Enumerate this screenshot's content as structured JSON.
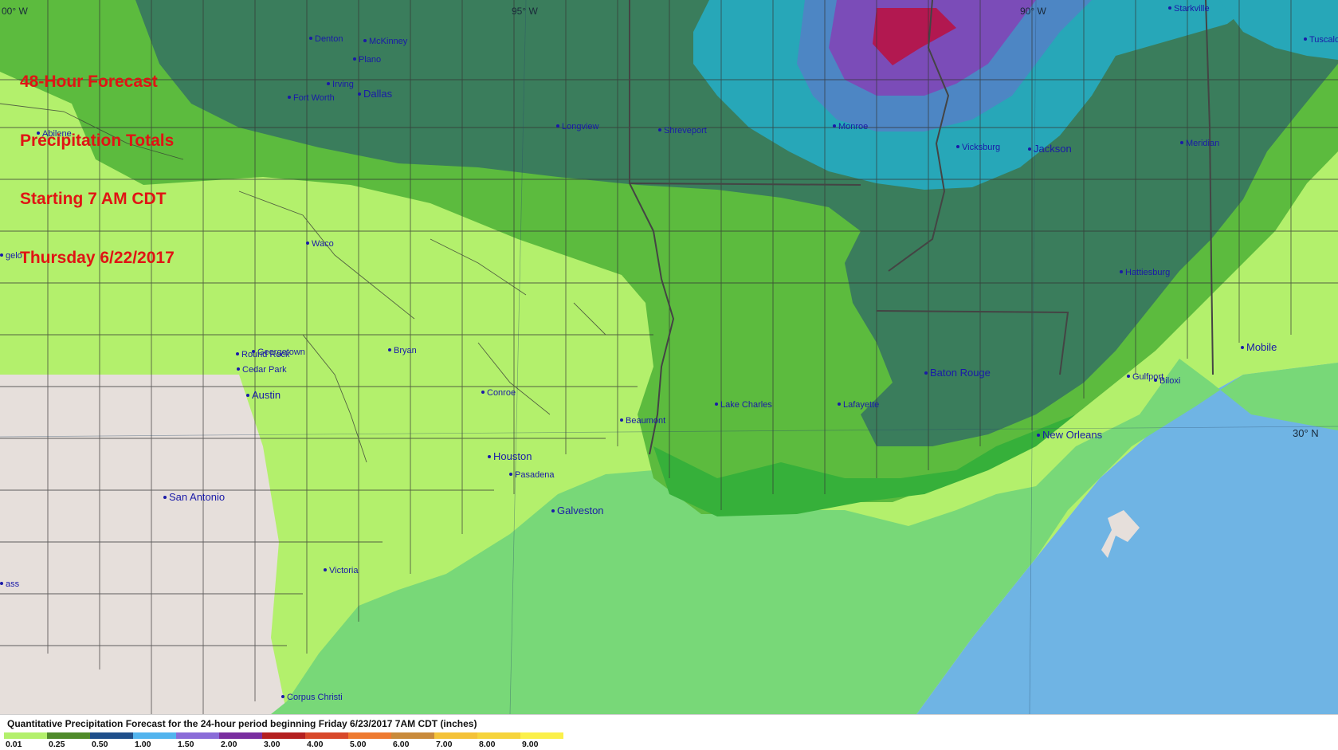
{
  "title_lines": [
    "48-Hour Forecast",
    "Precipitation Totals",
    "Starting 7 AM CDT",
    "Thursday 6/22/2017"
  ],
  "graticule_labels": {
    "lon_100": "00° W",
    "lon_95": "95° W",
    "lon_90": "90° W",
    "lat_30": "30° N"
  },
  "legend": {
    "title": "Quantitative Precipitation Forecast for the 24-hour period beginning Friday 6/23/2017 7AM CDT (inches)",
    "items": [
      {
        "value": "0.01",
        "color": "#b3f06c"
      },
      {
        "value": "0.25",
        "color": "#4f8a2a"
      },
      {
        "value": "0.50",
        "color": "#1f4f8a"
      },
      {
        "value": "1.00",
        "color": "#52b4ee"
      },
      {
        "value": "1.50",
        "color": "#8a6cd8"
      },
      {
        "value": "2.00",
        "color": "#7a2ea0"
      },
      {
        "value": "3.00",
        "color": "#b42020"
      },
      {
        "value": "4.00",
        "color": "#d8482a"
      },
      {
        "value": "5.00",
        "color": "#ee7a30"
      },
      {
        "value": "6.00",
        "color": "#c98a3a"
      },
      {
        "value": "7.00",
        "color": "#f4c238"
      },
      {
        "value": "8.00",
        "color": "#f6d43c"
      },
      {
        "value": "9.00",
        "color": "#fbf04a"
      }
    ]
  },
  "colors": {
    "land_no_precip": "#e6dfdb",
    "gulf": "#6fb4e4",
    "light_green": "#b3f06c",
    "mid_green": "#5cbb3e",
    "bright_green": "#36b03a",
    "gulf_green": "#78d878",
    "dark_green": "#3a7d5c",
    "teal": "#27a7b8",
    "steel_blue": "#4d86c4",
    "purple": "#7b4cb8",
    "crimson": "#b21850",
    "title_red": "#e01414",
    "city_label": "#1a1aa8"
  },
  "cities": [
    {
      "name": "Denton"
    },
    {
      "name": "McKinney"
    },
    {
      "name": "Plano"
    },
    {
      "name": "Irving"
    },
    {
      "name": "Fort Worth"
    },
    {
      "name": "Dallas"
    },
    {
      "name": "Abilene"
    },
    {
      "name": "Longview"
    },
    {
      "name": "Shreveport"
    },
    {
      "name": "Monroe"
    },
    {
      "name": "Vicksburg"
    },
    {
      "name": "Jackson"
    },
    {
      "name": "Meridian"
    },
    {
      "name": "Starkville"
    },
    {
      "name": "Tuscaloo"
    },
    {
      "name": "Waco"
    },
    {
      "name": "gelo"
    },
    {
      "name": "Hattiesburg"
    },
    {
      "name": "Round Rock"
    },
    {
      "name": "Georgetown"
    },
    {
      "name": "Cedar Park"
    },
    {
      "name": "Bryan"
    },
    {
      "name": "Austin"
    },
    {
      "name": "Conroe"
    },
    {
      "name": "Beaumont"
    },
    {
      "name": "Lake Charles"
    },
    {
      "name": "Lafayette"
    },
    {
      "name": "Baton Rouge"
    },
    {
      "name": "Gulfport"
    },
    {
      "name": "Biloxi"
    },
    {
      "name": "Mobile"
    },
    {
      "name": "New Orleans"
    },
    {
      "name": "Houston"
    },
    {
      "name": "Pasadena"
    },
    {
      "name": "San Antonio"
    },
    {
      "name": "Galveston"
    },
    {
      "name": "Victoria"
    },
    {
      "name": "ass"
    },
    {
      "name": "Corpus Christi"
    }
  ]
}
